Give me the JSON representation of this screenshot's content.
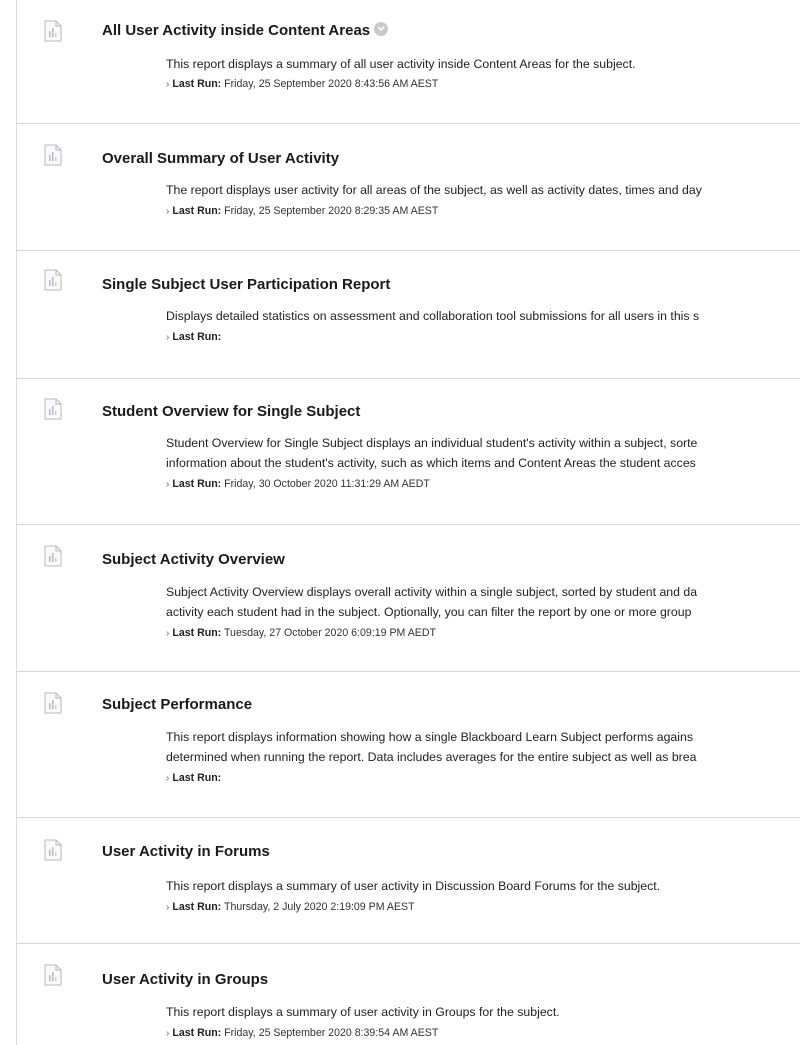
{
  "reports": [
    {
      "title": "All User Activity inside Content Areas",
      "description": [
        "This report displays a summary of all user activity inside Content Areas for the subject."
      ],
      "last_run_label": "Last Run:",
      "last_run_value": "Friday, 25 September 2020 8:43:56 AM AEST",
      "has_menu": true
    },
    {
      "title": "Overall Summary of User Activity",
      "description": [
        "The report displays user activity for all areas of the subject, as well as activity dates, times and day"
      ],
      "last_run_label": "Last Run:",
      "last_run_value": "Friday, 25 September 2020 8:29:35 AM AEST"
    },
    {
      "title": "Single Subject User Participation Report",
      "description": [
        "Displays detailed statistics on assessment and collaboration tool submissions for all users in this s"
      ],
      "last_run_label": "Last Run:",
      "last_run_value": ""
    },
    {
      "title": "Student Overview for Single Subject",
      "description": [
        "Student Overview for Single Subject displays an individual student's activity within a subject, sorte",
        "information about the student's activity, such as which items and Content Areas the student acces"
      ],
      "last_run_label": "Last Run:",
      "last_run_value": "Friday, 30 October 2020 11:31:29 AM AEDT"
    },
    {
      "title": "Subject Activity Overview",
      "description": [
        "Subject Activity Overview displays overall activity within a single subject, sorted by student and da",
        "activity each student had in the subject. Optionally, you can filter the report by one or more group"
      ],
      "last_run_label": "Last Run:",
      "last_run_value": "Tuesday, 27 October 2020 6:09:19 PM AEDT"
    },
    {
      "title": "Subject Performance",
      "description": [
        "This report displays information showing how a single Blackboard Learn Subject performs agains",
        "determined when running the report. Data includes averages for the entire subject as well as brea"
      ],
      "last_run_label": "Last Run:",
      "last_run_value": ""
    },
    {
      "title": "User Activity in Forums",
      "description": [
        "This report displays a summary of user activity in Discussion Board Forums for the subject."
      ],
      "last_run_label": "Last Run:",
      "last_run_value": "Thursday, 2 July 2020 2:19:09 PM AEST"
    },
    {
      "title": "User Activity in Groups",
      "description": [
        "This report displays a summary of user activity in Groups for the subject."
      ],
      "last_run_label": "Last Run:",
      "last_run_value": "Friday, 25 September 2020 8:39:54 AM AEST"
    }
  ],
  "icons": {
    "report": "report-document-icon",
    "menu": "chevron-down-icon",
    "caret": "chevron-right-icon"
  }
}
